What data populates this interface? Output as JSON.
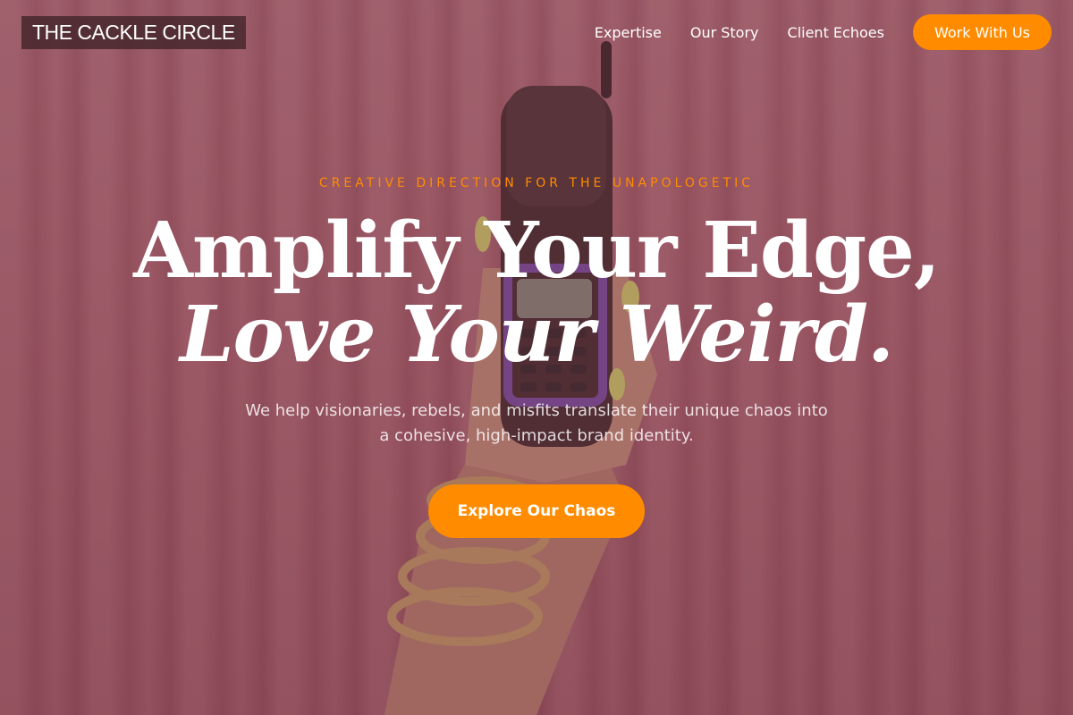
{
  "brand": {
    "name": "THE CACKLE CIRCLE"
  },
  "nav": {
    "items": [
      {
        "label": "Expertise"
      },
      {
        "label": "Our Story"
      },
      {
        "label": "Client Echoes"
      }
    ],
    "cta_label": "Work With Us"
  },
  "hero": {
    "eyebrow": "CREATIVE DIRECTION FOR THE UNAPOLOGETIC",
    "headline_line1": "Amplify Your Edge,",
    "headline_line2": "Love Your Weird.",
    "subtitle": "We help visionaries, rebels, and misfits translate their unique chaos into a cohesive, high-impact brand identity.",
    "cta_label": "Explore Our Chaos"
  },
  "colors": {
    "accent": "#ff8c00",
    "overlay": "#6e3746",
    "logo_bg": "#46282d",
    "text": "#ffffff"
  }
}
